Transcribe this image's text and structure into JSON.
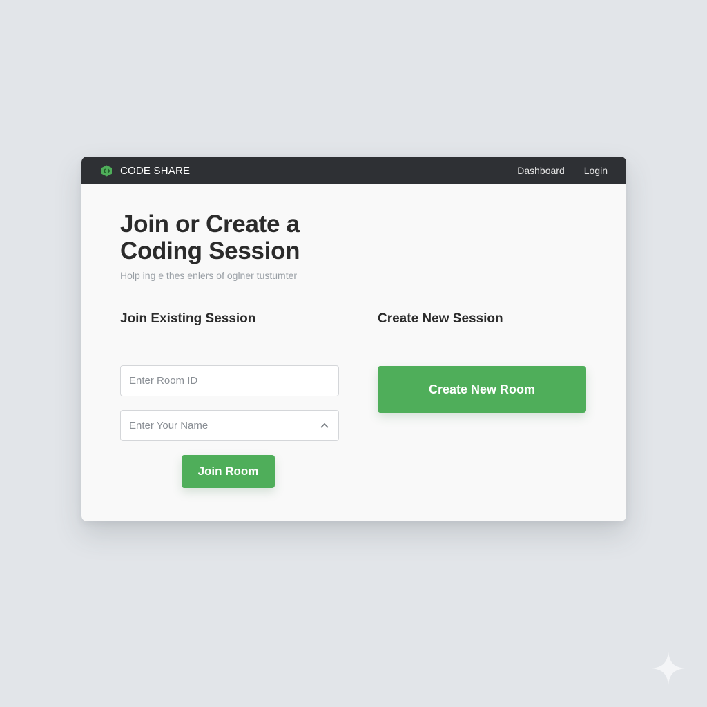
{
  "navbar": {
    "brand": "CODE SHARE",
    "brand_icon": "code-box-icon",
    "links": [
      {
        "label": "Dashboard"
      },
      {
        "label": "Login"
      }
    ]
  },
  "main": {
    "title": "Join or Create a Coding Session",
    "subtitle": "Holp ing e thes enlers of oglner tustumter"
  },
  "join": {
    "heading": "Join Existing Session",
    "room_id_placeholder": "Enter Room ID",
    "room_id_value": "",
    "name_placeholder": "Enter Your Name",
    "name_value": "",
    "name_icon": "chevron-up-icon",
    "button_label": "Join Room"
  },
  "create": {
    "heading": "Create New Session",
    "button_label": "Create New Room"
  },
  "colors": {
    "accent": "#4fae5a",
    "navbar_bg": "#2e3034",
    "page_bg": "#e2e5e9"
  }
}
